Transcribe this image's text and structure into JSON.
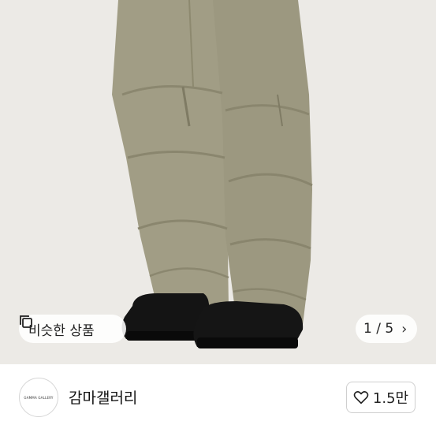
{
  "product": {
    "image_icon": "product-photo-wide-leg-pants",
    "similar_button": {
      "label": "비슷한 상품",
      "icon": "copy-icon"
    },
    "image_counter": {
      "text": "1 / 5",
      "icon": "chevron-right-icon"
    }
  },
  "seller": {
    "avatar_text": "GAMMA GALLERY",
    "name": "감마갤러리"
  },
  "like": {
    "icon": "heart-outline-icon",
    "count": "1.5만"
  },
  "colors": {
    "pants": "#9f9b83",
    "boots": "#111111",
    "background": "#eceae6"
  }
}
